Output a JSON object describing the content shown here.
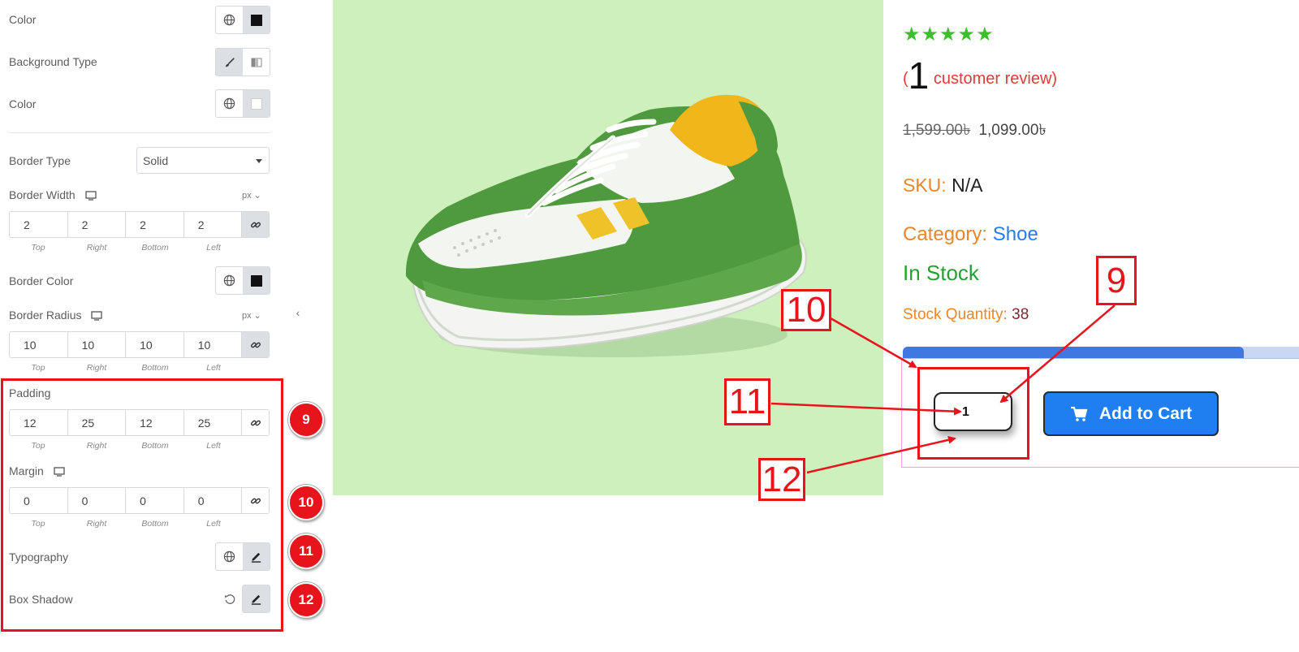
{
  "panel": {
    "color1_label": "Color",
    "background_type_label": "Background Type",
    "color2_label": "Color",
    "border_type_label": "Border Type",
    "border_type_value": "Solid",
    "border_width_label": "Border Width",
    "border_width_unit": "px",
    "border_width": {
      "top": "2",
      "right": "2",
      "bottom": "2",
      "left": "2"
    },
    "border_color_label": "Border Color",
    "border_radius_label": "Border Radius",
    "border_radius_unit": "px",
    "border_radius": {
      "top": "10",
      "right": "10",
      "bottom": "10",
      "left": "10"
    },
    "padding_label": "Padding",
    "padding": {
      "top": "12",
      "right": "25",
      "bottom": "12",
      "left": "25"
    },
    "margin_label": "Margin",
    "margin": {
      "top": "0",
      "right": "0",
      "bottom": "0",
      "left": "0"
    },
    "typography_label": "Typography",
    "box_shadow_label": "Box Shadow",
    "side_labels": {
      "top": "Top",
      "right": "Right",
      "bottom": "Bottom",
      "left": "Left"
    }
  },
  "badges": [
    "9",
    "10",
    "11",
    "12"
  ],
  "product": {
    "stars": "★★★★★",
    "review_open": "(",
    "review_count": "1",
    "review_text": "customer review)",
    "price_old": "1,599.00৳",
    "price_new": "1,099.00৳",
    "sku_label": "SKU:",
    "sku_value": "N/A",
    "category_label": "Category:",
    "category_value": "Shoe",
    "stock_status": "In Stock",
    "stock_qty_label": "Stock Quantity:",
    "stock_qty_value": "38",
    "quantity_value": "1",
    "add_to_cart_label": "Add to Cart"
  },
  "annotations": {
    "n9": "9",
    "n10": "10",
    "n11": "11",
    "n12": "12"
  },
  "colors": {
    "annotation_red": "#e8141c",
    "button_blue": "#1f7ff0",
    "stock_green": "#27a033",
    "label_orange": "#e8872a",
    "photo_bg": "#cdf0bc"
  }
}
